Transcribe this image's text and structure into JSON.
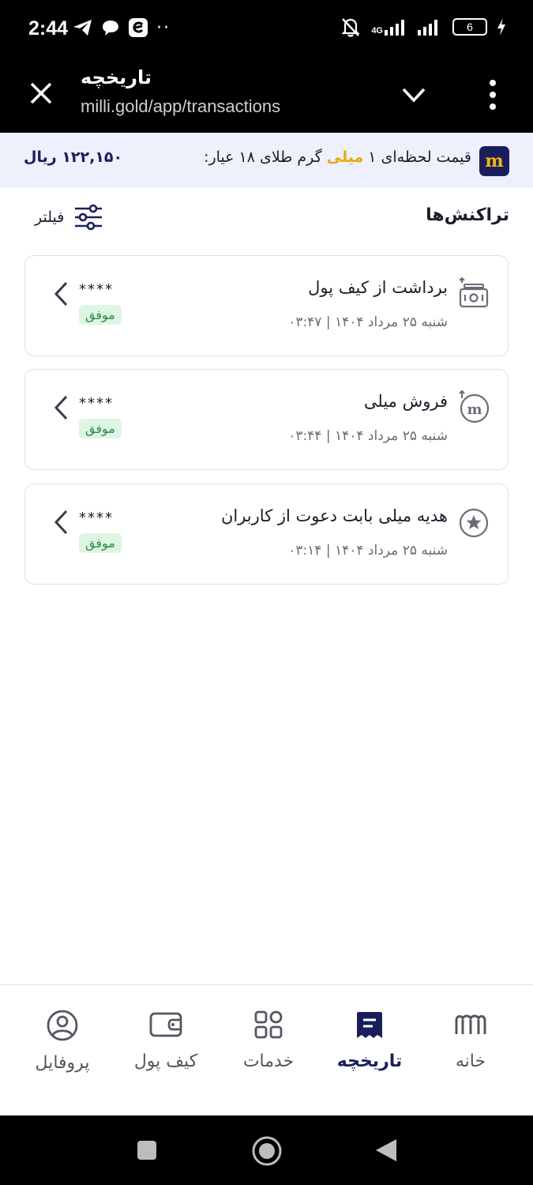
{
  "status_bar": {
    "time": "2:44",
    "dots": "··",
    "network": "4G",
    "battery": "6"
  },
  "browser": {
    "title": "تاریخچه",
    "url": "milli.gold/app/transactions"
  },
  "price_banner": {
    "logo": "m",
    "text_before": "قیمت لحظه‌ای ۱ ",
    "highlight": "میلی",
    "text_after": " گرم طلای ۱۸ عیار:",
    "value": "۱۲۲,۱۵۰ ریال",
    "highlight_color": "#e7a916"
  },
  "section": {
    "title": "تراکنش‌ها",
    "filter_label": "فیلتر"
  },
  "transactions": [
    {
      "title": "برداشت از کیف پول",
      "date": "شنبه ۲۵ مرداد ۱۴۰۴ | ۰۳:۴۷",
      "amount": "****",
      "status": "موفق",
      "icon": "cash-withdraw-icon"
    },
    {
      "title": "فروش میلی",
      "date": "شنبه ۲۵ مرداد ۱۴۰۴ | ۰۳:۴۴",
      "amount": "****",
      "status": "موفق",
      "icon": "milli-sell-icon"
    },
    {
      "title": "هدیه میلی بابت دعوت از کاربران",
      "date": "شنبه ۲۵ مرداد ۱۴۰۴ | ۰۳:۱۴",
      "amount": "****",
      "status": "موفق",
      "icon": "star-icon"
    }
  ],
  "bottom_nav": {
    "home": "خانه",
    "history": "تاریخچه",
    "services": "خدمات",
    "wallet": "کیف پول",
    "profile": "پروفایل",
    "active_color": "#1a1f5c"
  }
}
